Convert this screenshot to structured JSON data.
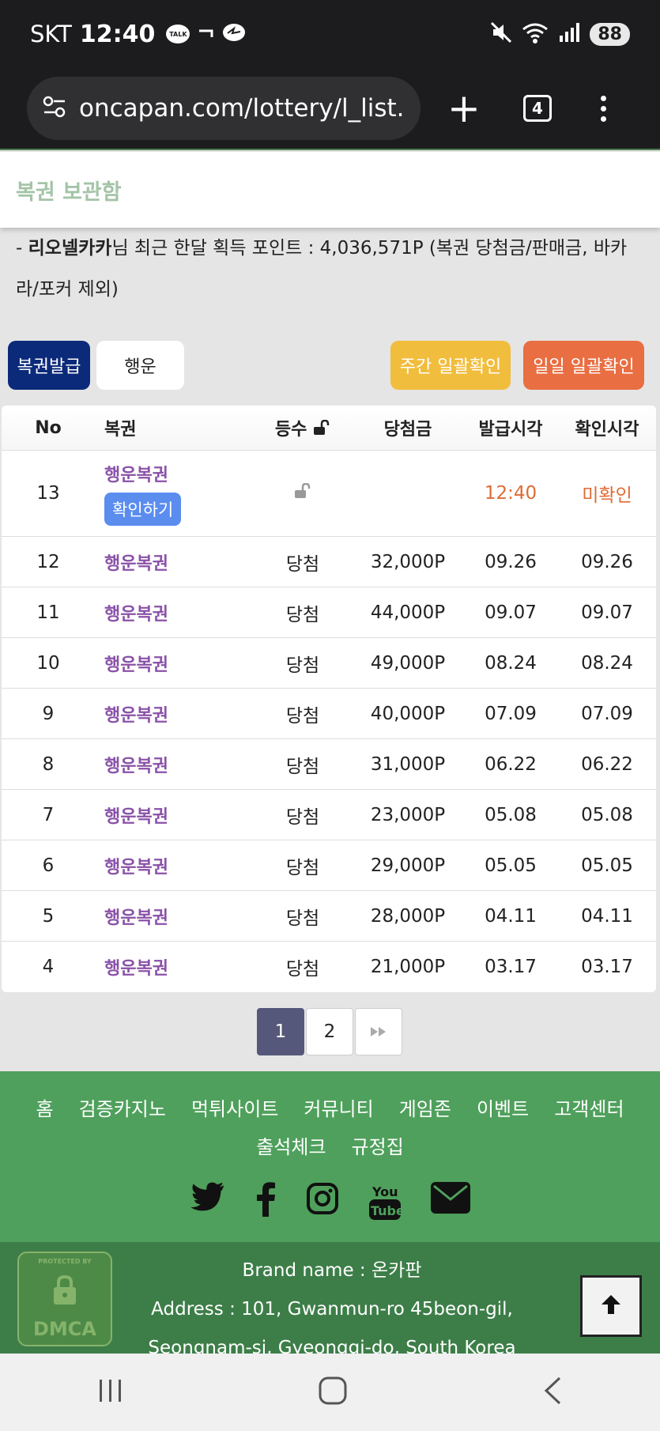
{
  "status_bar": {
    "carrier": "SKT",
    "time": "12:40",
    "talk_label": "TALK",
    "battery": "88"
  },
  "browser": {
    "url": "oncapan.com/lottery/l_list.ph",
    "tab_count": "4"
  },
  "page": {
    "title": "복권 보관함",
    "points_prefix": "- ",
    "username": "리오넬카카",
    "points_text": "님 최근 한달 획득 포인트 : 4,036,571P (복권 당첨금/판매금, 바카라/포커 제외)"
  },
  "buttons": {
    "issue": "복권발급",
    "luck": "행운",
    "weekly": "주간 일괄확인",
    "daily": "일일 일괄확인"
  },
  "table": {
    "headers": {
      "no": "No",
      "name": "복권",
      "rank": "등수",
      "prize": "당첨금",
      "issued": "발급시각",
      "checked": "확인시각"
    },
    "first_row": {
      "no": "13",
      "name": "행운복권",
      "confirm": "확인하기",
      "issued": "12:40",
      "checked": "미확인"
    },
    "rows": [
      {
        "no": "12",
        "name": "행운복권",
        "rank": "당첨",
        "prize": "32,000P",
        "issued": "09.26",
        "checked": "09.26"
      },
      {
        "no": "11",
        "name": "행운복권",
        "rank": "당첨",
        "prize": "44,000P",
        "issued": "09.07",
        "checked": "09.07"
      },
      {
        "no": "10",
        "name": "행운복권",
        "rank": "당첨",
        "prize": "49,000P",
        "issued": "08.24",
        "checked": "08.24"
      },
      {
        "no": "9",
        "name": "행운복권",
        "rank": "당첨",
        "prize": "40,000P",
        "issued": "07.09",
        "checked": "07.09"
      },
      {
        "no": "8",
        "name": "행운복권",
        "rank": "당첨",
        "prize": "31,000P",
        "issued": "06.22",
        "checked": "06.22"
      },
      {
        "no": "7",
        "name": "행운복권",
        "rank": "당첨",
        "prize": "23,000P",
        "issued": "05.08",
        "checked": "05.08"
      },
      {
        "no": "6",
        "name": "행운복권",
        "rank": "당첨",
        "prize": "29,000P",
        "issued": "05.05",
        "checked": "05.05"
      },
      {
        "no": "5",
        "name": "행운복권",
        "rank": "당첨",
        "prize": "28,000P",
        "issued": "04.11",
        "checked": "04.11"
      },
      {
        "no": "4",
        "name": "행운복권",
        "rank": "당첨",
        "prize": "21,000P",
        "issued": "03.17",
        "checked": "03.17"
      }
    ]
  },
  "pagination": {
    "page1": "1",
    "page2": "2"
  },
  "footer": {
    "links": [
      "홈",
      "검증카지노",
      "먹튀사이트",
      "커뮤니티",
      "게임존",
      "이벤트",
      "고객센터",
      "출석체크",
      "규정집"
    ],
    "brand_line": "Brand name : 온카판",
    "address_line": "Address : 101, Gwanmun-ro 45beon-gil,",
    "address_line2": "Seongnam-si, Gyeonggi-do, South Korea",
    "dmca_protected": "PROTECTED BY",
    "dmca_label": "DMCA"
  }
}
